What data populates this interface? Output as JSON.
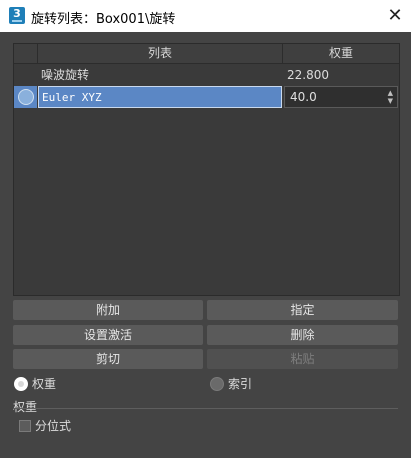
{
  "window": {
    "title": "旋转列表：Box001\\旋转",
    "icon_label": "3",
    "close_glyph": "✕"
  },
  "table": {
    "headers": {
      "list": "列表",
      "weight": "权重"
    },
    "rows": [
      {
        "name": "噪波旋转",
        "weight": "22.800",
        "selected": false
      },
      {
        "name": "Euler XYZ",
        "weight": "40.0",
        "selected": true
      }
    ],
    "spinner_arrows": "▲▼"
  },
  "buttons": {
    "append": "附加",
    "assign": "指定",
    "set_active": "设置激活",
    "delete": "删除",
    "cut": "剪切",
    "paste": "粘贴"
  },
  "options": {
    "weight_radio": "权重",
    "index_radio": "索引",
    "selected": "weight"
  },
  "weights_section": {
    "label": "权重",
    "average_checkbox": "分位式",
    "average_checked": false
  },
  "colors": {
    "background": "#444444",
    "selection": "#5b87c5",
    "button": "#5a5a5a"
  }
}
